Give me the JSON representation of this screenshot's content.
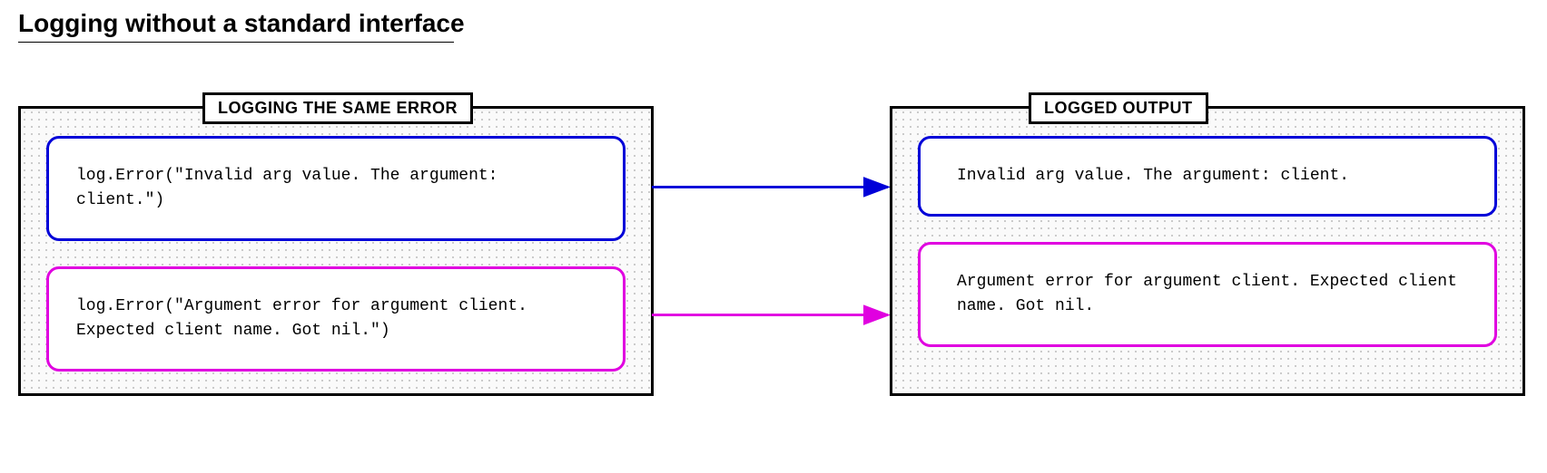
{
  "title": "Logging without a standard interface",
  "panels": {
    "left": {
      "label": "LOGGING THE SAME ERROR",
      "boxes": [
        {
          "color": "blue",
          "text": "log.Error(\"Invalid arg value. The argument: client.\")"
        },
        {
          "color": "magenta",
          "text": "log.Error(\"Argument error for argument client. Expected client name. Got nil.\")"
        }
      ]
    },
    "right": {
      "label": "LOGGED OUTPUT",
      "boxes": [
        {
          "color": "blue",
          "text": "Invalid arg value. The argument: client."
        },
        {
          "color": "magenta",
          "text": "Argument error for argument client. Expected client name. Got nil."
        }
      ]
    }
  },
  "colors": {
    "blue": "#0000d8",
    "magenta": "#e000e0"
  }
}
